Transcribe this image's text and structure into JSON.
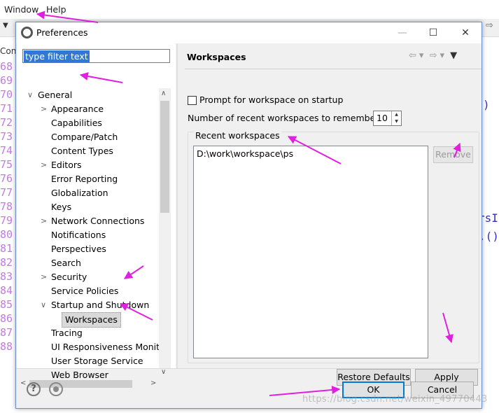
{
  "menubar": {
    "items": [
      "Window",
      "Help"
    ]
  },
  "background": {
    "console_tab": "Cont",
    "line_numbers": [
      "68",
      "69",
      "70",
      "71",
      "72",
      "73",
      "74",
      "75",
      "76",
      "77",
      "78",
      "79",
      "80",
      "81",
      "82",
      "83",
      "84",
      "85",
      "86",
      "87",
      "88"
    ],
    "code_fragments": [
      ")",
      "rsI",
      ".()",
      "("
    ]
  },
  "dialog": {
    "title": "Preferences",
    "filter_text": "type filter text",
    "tree": [
      {
        "label": "General",
        "twisty": "v",
        "indent": 0
      },
      {
        "label": "Appearance",
        "twisty": ">",
        "indent": 1
      },
      {
        "label": "Capabilities",
        "twisty": "",
        "indent": 1
      },
      {
        "label": "Compare/Patch",
        "twisty": "",
        "indent": 1
      },
      {
        "label": "Content Types",
        "twisty": "",
        "indent": 1
      },
      {
        "label": "Editors",
        "twisty": ">",
        "indent": 1
      },
      {
        "label": "Error Reporting",
        "twisty": "",
        "indent": 1
      },
      {
        "label": "Globalization",
        "twisty": "",
        "indent": 1
      },
      {
        "label": "Keys",
        "twisty": "",
        "indent": 1
      },
      {
        "label": "Network Connections",
        "twisty": ">",
        "indent": 1
      },
      {
        "label": "Notifications",
        "twisty": "",
        "indent": 1
      },
      {
        "label": "Perspectives",
        "twisty": "",
        "indent": 1
      },
      {
        "label": "Search",
        "twisty": "",
        "indent": 1
      },
      {
        "label": "Security",
        "twisty": ">",
        "indent": 1
      },
      {
        "label": "Service Policies",
        "twisty": "",
        "indent": 1
      },
      {
        "label": "Startup and Shutdown",
        "twisty": "v",
        "indent": 1
      },
      {
        "label": "Workspaces",
        "twisty": "",
        "indent": 2,
        "selected": true
      },
      {
        "label": "Tracing",
        "twisty": "",
        "indent": 1
      },
      {
        "label": "UI Responsiveness Monito",
        "twisty": "",
        "indent": 1
      },
      {
        "label": "User Storage Service",
        "twisty": "",
        "indent": 1
      },
      {
        "label": "Web Browser",
        "twisty": "",
        "indent": 1
      }
    ],
    "page": {
      "title": "Workspaces",
      "prompt_label": "Prompt for workspace on startup",
      "prompt_checked": false,
      "recent_count_label": "Number of recent workspaces to remember:",
      "recent_count_value": "10",
      "recent_group_label": "Recent workspaces",
      "recent_items": [
        "D:\\work\\workspace\\ps"
      ],
      "remove_label": "Remove",
      "restore_defaults_label": "Restore Defaults",
      "apply_label": "Apply"
    },
    "ok_label": "OK",
    "cancel_label": "Cancel"
  },
  "watermark": "https://blog.csdn.net/weixin_49770443",
  "colors": {
    "annotation_arrow": "#e020e0",
    "selection": "#3178d6",
    "default_button_border": "#0078d7"
  }
}
